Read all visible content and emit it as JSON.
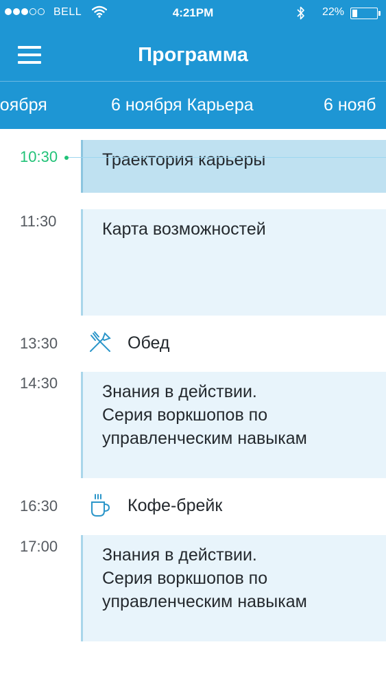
{
  "status_bar": {
    "carrier": "BELL",
    "time": "4:21PM",
    "battery_percent": "22%",
    "battery_level": 0.22,
    "signal_strength": 3,
    "signal_max": 5,
    "icons": [
      "wifi-icon",
      "bluetooth-icon",
      "battery-icon"
    ]
  },
  "nav": {
    "title": "Программа",
    "menu_icon": "hamburger-menu-icon"
  },
  "day_tabs": {
    "prev_label": "ноября",
    "current_label": "6 ноября Карьера",
    "next_label": "6 нояб"
  },
  "schedule": {
    "now_time": "10:30",
    "items": [
      {
        "type": "session",
        "time": "10:30",
        "title": "Траектория карьеры",
        "active": true
      },
      {
        "type": "session",
        "time": "11:30",
        "title": "Карта возможностей"
      },
      {
        "type": "break",
        "time": "13:30",
        "title": "Обед",
        "icon": "fork-knife-icon"
      },
      {
        "type": "session",
        "time": "14:30",
        "title": "Знания в действии.\nСерия воркшопов по управленческим навыкам"
      },
      {
        "type": "break",
        "time": "16:30",
        "title": "Кофе-брейк",
        "icon": "coffee-cup-icon"
      },
      {
        "type": "session",
        "time": "17:00",
        "title": "Знания в действии.\nСерия воркшопов по управленческим навыкам"
      }
    ]
  },
  "colors": {
    "header_bg": "#1e96d4",
    "session_bg": "#e8f4fb",
    "session_active_bg": "#bfe1f1",
    "session_border": "#a9d6ea",
    "current_time": "#21c277",
    "icon_color": "#2a95c9"
  }
}
